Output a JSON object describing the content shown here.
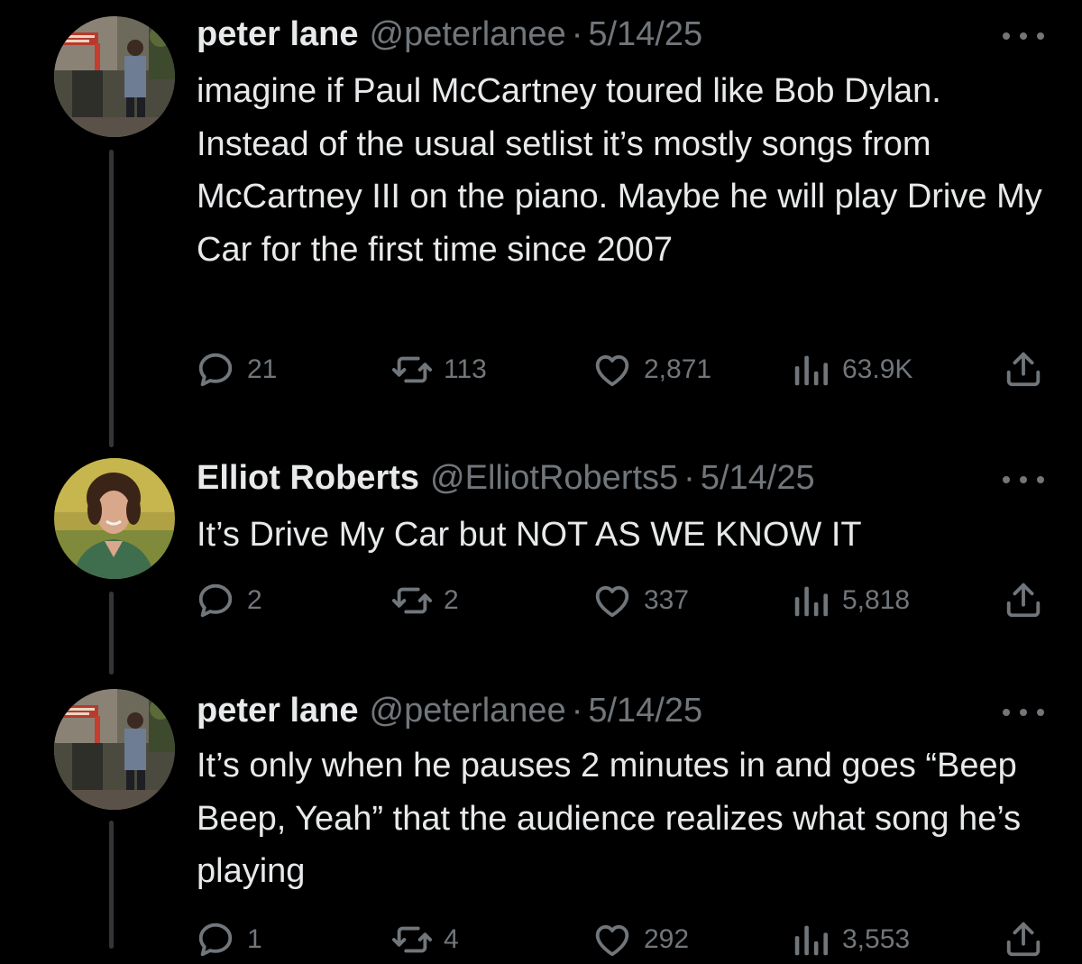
{
  "tweets": [
    {
      "name": "peter lane",
      "handle": "@peterlanee",
      "separator": "·",
      "date": "5/14/25",
      "text": "imagine if Paul McCartney toured like Bob Dylan. Instead of the usual setlist it’s mostly songs from McCartney III on the piano. Maybe he will play Drive My Car for the first time since 2007",
      "replies": "21",
      "reposts": "113",
      "likes": "2,871",
      "views": "63.9K",
      "avatar": "peter-lane-avatar"
    },
    {
      "name": "Elliot Roberts",
      "handle": "@ElliotRoberts5",
      "separator": "·",
      "date": "5/14/25",
      "text": "It’s Drive My Car but NOT AS WE KNOW IT",
      "replies": "2",
      "reposts": "2",
      "likes": "337",
      "views": "5,818",
      "avatar": "elliot-roberts-avatar"
    },
    {
      "name": "peter lane",
      "handle": "@peterlanee",
      "separator": "·",
      "date": "5/14/25",
      "text": "It’s only when he pauses 2 minutes in and goes “Beep Beep, Yeah” that the audience realizes what song he’s playing",
      "replies": "1",
      "reposts": "4",
      "likes": "292",
      "views": "3,553",
      "avatar": "peter-lane-avatar"
    }
  ],
  "icons": {
    "reply": "reply-icon",
    "repost": "repost-icon",
    "like": "heart-icon",
    "views": "views-icon",
    "share": "share-icon",
    "more": "more-icon"
  },
  "colors": {
    "background": "#000000",
    "text": "#e7e9ea",
    "secondary": "#71767b",
    "thread_line": "#333639"
  }
}
